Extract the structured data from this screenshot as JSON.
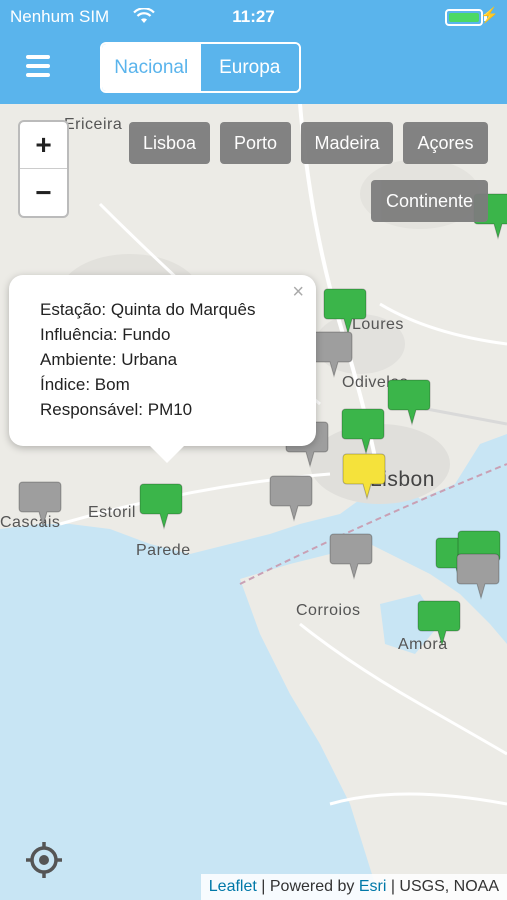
{
  "status": {
    "carrier": "Nenhum SIM",
    "time": "11:27",
    "battery_percent": 100
  },
  "nav": {
    "tabs": [
      "Nacional",
      "Europa"
    ],
    "selected": "Nacional"
  },
  "map": {
    "zoom_in": "+",
    "zoom_out": "−",
    "regions": [
      "Lisboa",
      "Porto",
      "Madeira",
      "Açores",
      "Continente"
    ],
    "places": {
      "ericeira": "Ericeira",
      "loures": "Loures",
      "odivelas": "Odivelas",
      "lisbon": "Lisbon",
      "estoril": "Estoril",
      "cascais": "Cascais",
      "parede": "Parede",
      "corroios": "Corroios",
      "amora": "Amora"
    },
    "marker_colors": {
      "good": "#3bb54a",
      "moderate": "#f5e23b",
      "no_data": "#9e9e9e"
    },
    "popup": {
      "station": "Estação: Quinta do Marquês",
      "influence": "Influência: Fundo",
      "environment": "Ambiente: Urbana",
      "index": "Índice: Bom",
      "responsible": "Responsável: PM10",
      "close": "×"
    },
    "attribution": {
      "leaflet": "Leaflet",
      "powered": " | Powered by ",
      "esri": "Esri",
      "sources": " | USGS, NOAA"
    }
  }
}
